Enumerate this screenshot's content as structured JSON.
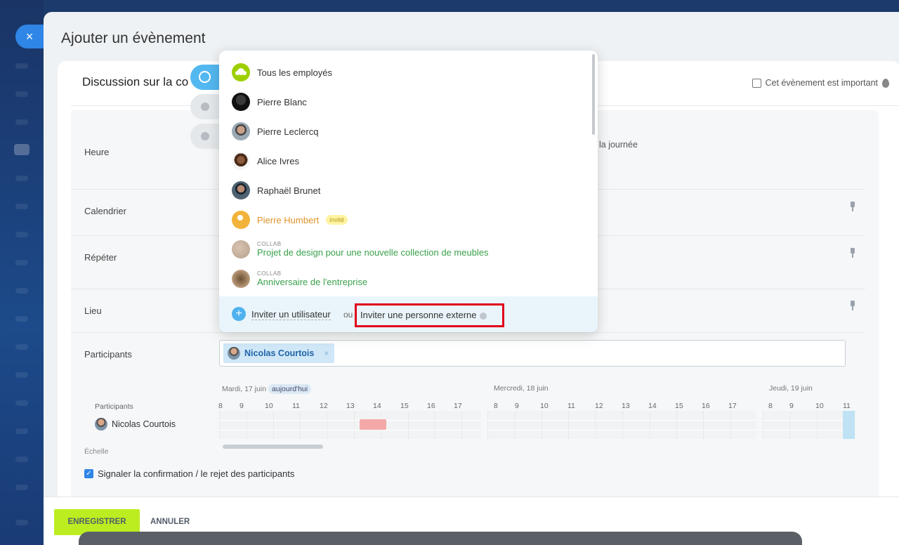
{
  "slider": {
    "title": "Ajouter un évènement",
    "close_icon": "×"
  },
  "event": {
    "name": "Discussion sur la co",
    "important_label": "Cet évènement est important"
  },
  "form": {
    "time_label": "Heure",
    "allday_label": "la journée",
    "calendar_label": "Calendrier",
    "repeat_label": "Répéter",
    "location_label": "Lieu",
    "participants_label": "Participants",
    "participant_chip": "Nicolas Courtois",
    "chip_remove": "×"
  },
  "timeline": {
    "days": [
      {
        "label": "Mardi, 17 juin",
        "badge": "aujourd'hui"
      },
      {
        "label": "Mercredi, 18 juin"
      },
      {
        "label": "Jeudi, 19 juin"
      }
    ],
    "hours_day1": [
      "8",
      "9",
      "10",
      "11",
      "12",
      "13",
      "14",
      "15",
      "16",
      "17"
    ],
    "hours_day2": [
      "8",
      "9",
      "10",
      "11",
      "12",
      "13",
      "14",
      "15",
      "16",
      "17"
    ],
    "hours_day3": [
      "8",
      "9",
      "10",
      "11"
    ],
    "participants_label": "Participants",
    "person": "Nicolas Courtois",
    "scale_label": "Échelle"
  },
  "notify_label": "Signaler la confirmation / le rejet des participants",
  "footer": {
    "save_label": "ENREGISTRER",
    "cancel_label": "ANNULER"
  },
  "dropdown": {
    "items": [
      {
        "name": "Tous les employés",
        "type": "group"
      },
      {
        "name": "Pierre Blanc",
        "type": "user"
      },
      {
        "name": "Pierre Leclercq",
        "type": "user"
      },
      {
        "name": "Alice Ivres",
        "type": "user"
      },
      {
        "name": "Raphaël Brunet",
        "type": "user"
      },
      {
        "name": "Pierre Humbert",
        "type": "invited",
        "badge": "invité"
      },
      {
        "name": "Projet de design pour une nouvelle collection de meubles",
        "type": "collab",
        "tag": "COLLAB"
      },
      {
        "name": "Anniversaire de l'entreprise",
        "type": "collab",
        "tag": "COLLAB"
      }
    ],
    "invite_user": "Inviter un utilisateur",
    "or": "ou",
    "invite_external": "Inviter une personne externe",
    "plus_icon": "+"
  },
  "colors": {
    "accent": "#2f86e6",
    "save": "#bbed21",
    "highlight": "#e0001b",
    "collab": "#3aa14c"
  }
}
